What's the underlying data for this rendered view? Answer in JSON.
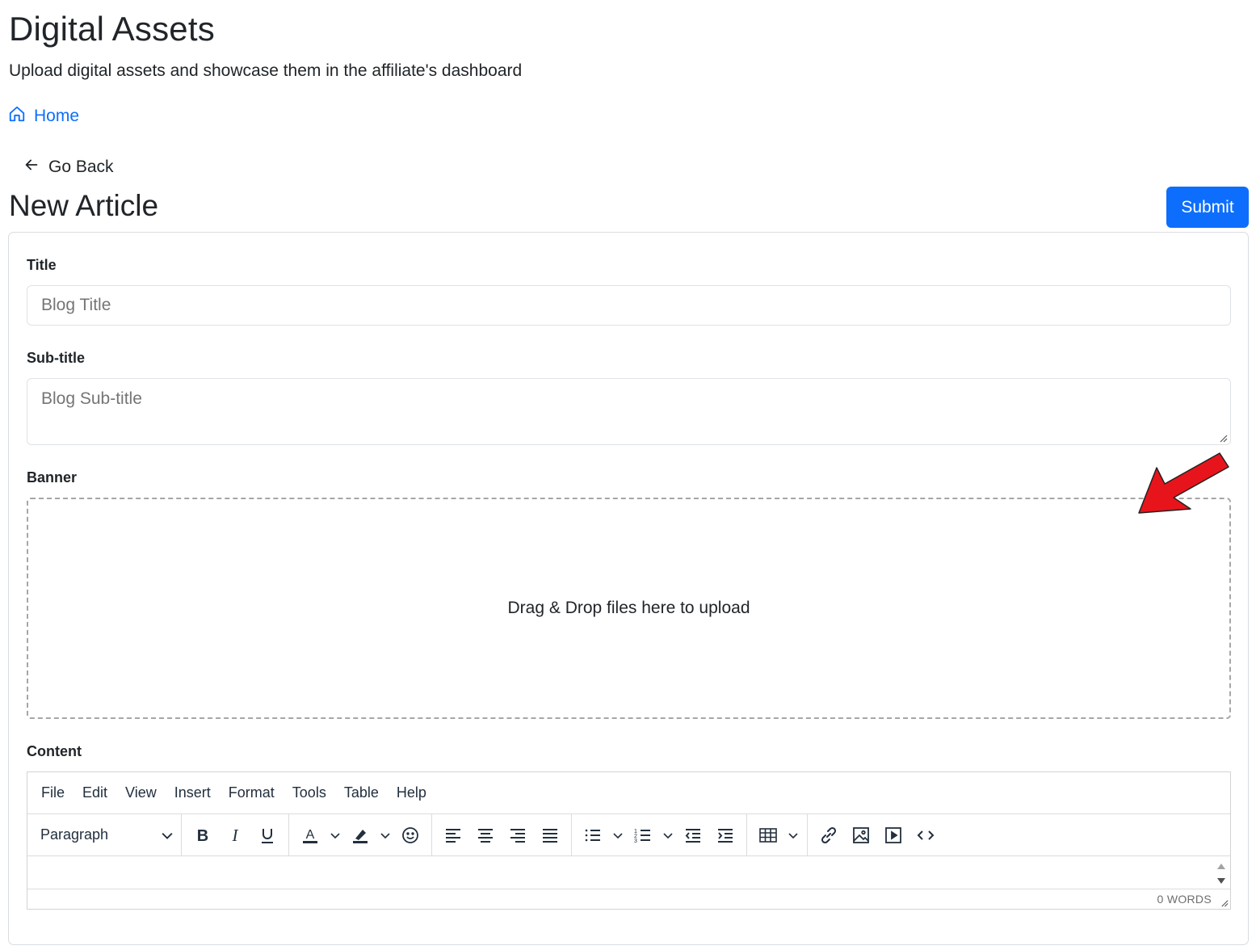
{
  "header": {
    "title": "Digital Assets",
    "subtitle": "Upload digital assets and showcase them in the affiliate's dashboard"
  },
  "breadcrumb": {
    "home_label": "Home",
    "home_icon": "home-icon"
  },
  "nav": {
    "go_back_label": "Go Back",
    "back_icon": "arrow-left-icon"
  },
  "form": {
    "heading": "New Article",
    "submit_label": "Submit",
    "title_label": "Title",
    "title_placeholder": "Blog Title",
    "subtitle_label": "Sub-title",
    "subtitle_placeholder": "Blog Sub-title",
    "banner_label": "Banner",
    "dropzone_text": "Drag & Drop files here to upload",
    "content_label": "Content"
  },
  "editor": {
    "menu": [
      "File",
      "Edit",
      "View",
      "Insert",
      "Format",
      "Tools",
      "Table",
      "Help"
    ],
    "block_format": "Paragraph",
    "word_count": "0 WORDS",
    "toolbar_icons": [
      "bold-icon",
      "italic-icon",
      "underline-icon",
      "text-color-icon",
      "highlight-color-icon",
      "emoji-icon",
      "align-left-icon",
      "align-center-icon",
      "align-right-icon",
      "align-justify-icon",
      "bullet-list-icon",
      "numbered-list-icon",
      "outdent-icon",
      "indent-icon",
      "table-icon",
      "link-icon",
      "image-icon",
      "media-icon",
      "source-code-icon"
    ]
  },
  "colors": {
    "primary": "#0d6efd",
    "annotation_arrow": "#e8141b",
    "text": "#212529",
    "editor_text": "#222f3e"
  }
}
